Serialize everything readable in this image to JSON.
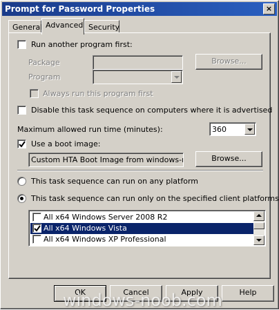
{
  "window": {
    "title": "Prompt for Password Properties",
    "close_glyph": "×"
  },
  "tabs": [
    {
      "label": "General",
      "active": false
    },
    {
      "label": "Advanced",
      "active": true
    },
    {
      "label": "Security",
      "active": false
    }
  ],
  "advanced": {
    "run_another_program": {
      "label": "Run another program first:",
      "checked": false
    },
    "package_label": "Package",
    "package_value": "",
    "program_label": "Program",
    "program_value": "",
    "browse_package_label": "Browse...",
    "always_run": {
      "label": "Always run this program first",
      "checked": false,
      "enabled": false
    },
    "disable_task": {
      "label": "Disable this task sequence on computers where it is advertised",
      "checked": false
    },
    "max_runtime_label": "Maximum allowed run time (minutes):",
    "max_runtime_value": "360",
    "use_boot_image": {
      "label": "Use a boot image:",
      "checked": true
    },
    "boot_image_value": "Custom HTA  Boot Image from windows-noob",
    "browse_boot_label": "Browse...",
    "radio_any_platform": {
      "label": "This task sequence can run on any platform",
      "selected": false
    },
    "radio_specified_platforms": {
      "label": "This task sequence can run only on the specified client platforms",
      "selected": true
    },
    "platforms": [
      {
        "label": "All x64 Windows Server 2008 R2",
        "checked": false,
        "selected": false
      },
      {
        "label": "All x64 Windows Vista",
        "checked": true,
        "selected": true
      },
      {
        "label": "All x64 Windows XP Professional",
        "checked": false,
        "selected": false
      }
    ]
  },
  "buttons": {
    "ok": "OK",
    "cancel": "Cancel",
    "apply": "Apply",
    "help": "Help"
  },
  "watermark": "windows-noob.com",
  "colors": {
    "titlebar_start": "#1a3b8a",
    "titlebar_end": "#2a5fc0",
    "face": "#d4d0c8",
    "selection": "#0a246a"
  }
}
